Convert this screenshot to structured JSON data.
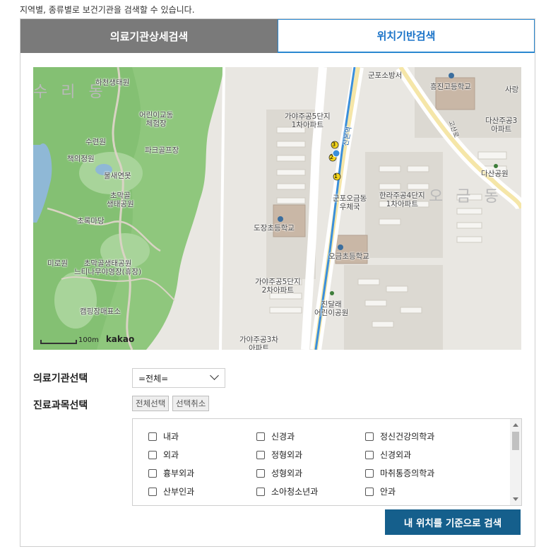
{
  "intro": "지역별, 종류별로 보건기관을 검색할 수 있습니다.",
  "tabs": [
    {
      "label": "의료기관상세검색",
      "active": true
    },
    {
      "label": "위치기반검색",
      "active": false
    }
  ],
  "map": {
    "labels": {
      "district1": "수 리 동",
      "district2": "오 금 동",
      "haecheon": "하천생태원",
      "childrenfarm": "어린이교동\n체험장",
      "suryeonwon": "수련원",
      "chaegui": "책의정원",
      "parkgolf": "파크골프장",
      "mulsae": "물새연못",
      "chomakgol": "초막골\n생태공원",
      "chorok": "초록마당",
      "miro": "미로원",
      "campground": "초막골생태공원\n느티나무야영장(휴장)",
      "campshop": "캠핑장매표소",
      "fire": "군포소방서",
      "heungjin": "흥진고등학교",
      "sarang": "사랑",
      "dasan3": "다산주공3\n아파트",
      "dasanpark": "다산공원",
      "gaya5_1": "가야주공5단지\n1차아파트",
      "postoffice": "군포오금동\n우체국",
      "hanla4": "한라주공4단지\n1차아파트",
      "dojang": "도장초등학교",
      "ogeum_school": "오금초등학교",
      "gaya5_2": "가야주공5단지\n2차아파트",
      "jindalrae": "진달래\n어린이공원",
      "gaya3": "가야주공3차\n아파트",
      "station": "산본역",
      "road": "고산로"
    },
    "scale": "100m",
    "brand": "kakao",
    "exits": [
      "1",
      "2",
      "3",
      "4"
    ]
  },
  "form": {
    "institution_label": "의료기관선택",
    "institution_value": "=전체=",
    "subject_label": "진료과목선택",
    "select_all": "전체선택",
    "deselect": "선택취소",
    "subjects": [
      "내과",
      "신경과",
      "정신건강의학과",
      "외과",
      "정형외과",
      "신경외과",
      "흉부외과",
      "성형외과",
      "마취통증의학과",
      "산부인과",
      "소아청소년과",
      "안과"
    ],
    "search_button": "내 위치를 기준으로 검색"
  }
}
